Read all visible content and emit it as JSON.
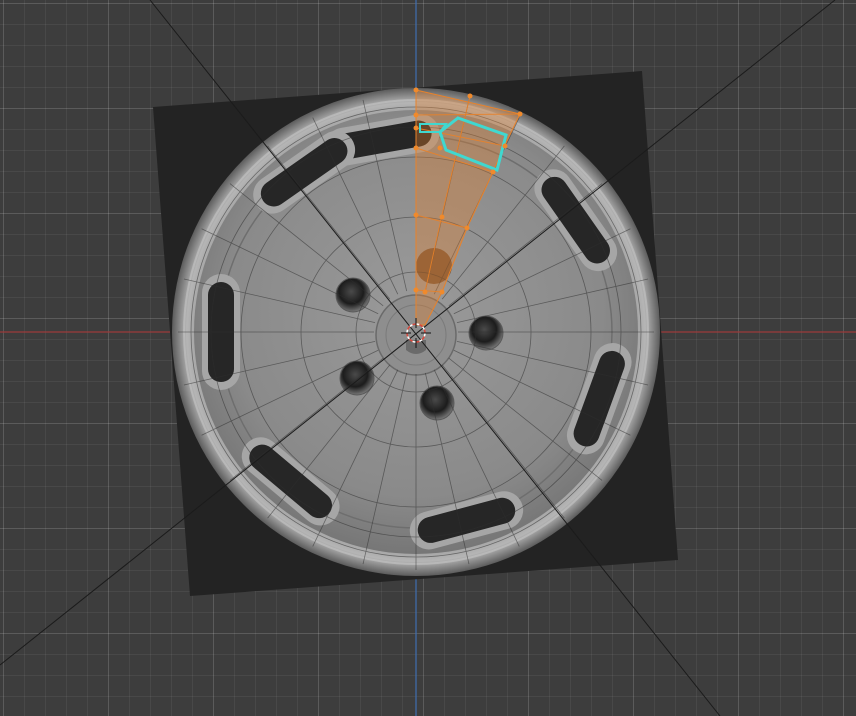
{
  "viewport": {
    "view_name": "",
    "colors": {
      "background": "#3d3d3d",
      "x_axis": "#9c3b3b",
      "y_axis": "#3f6fb0",
      "reference_card": "#232323",
      "wheel_face": "#858585",
      "selection_orange": "#e8822a",
      "active_face_cyan": "#3fd8d0",
      "cursor_red": "#d8483c"
    },
    "icons": [
      "3d-cursor-icon",
      "mesh-vertex-icon"
    ]
  }
}
